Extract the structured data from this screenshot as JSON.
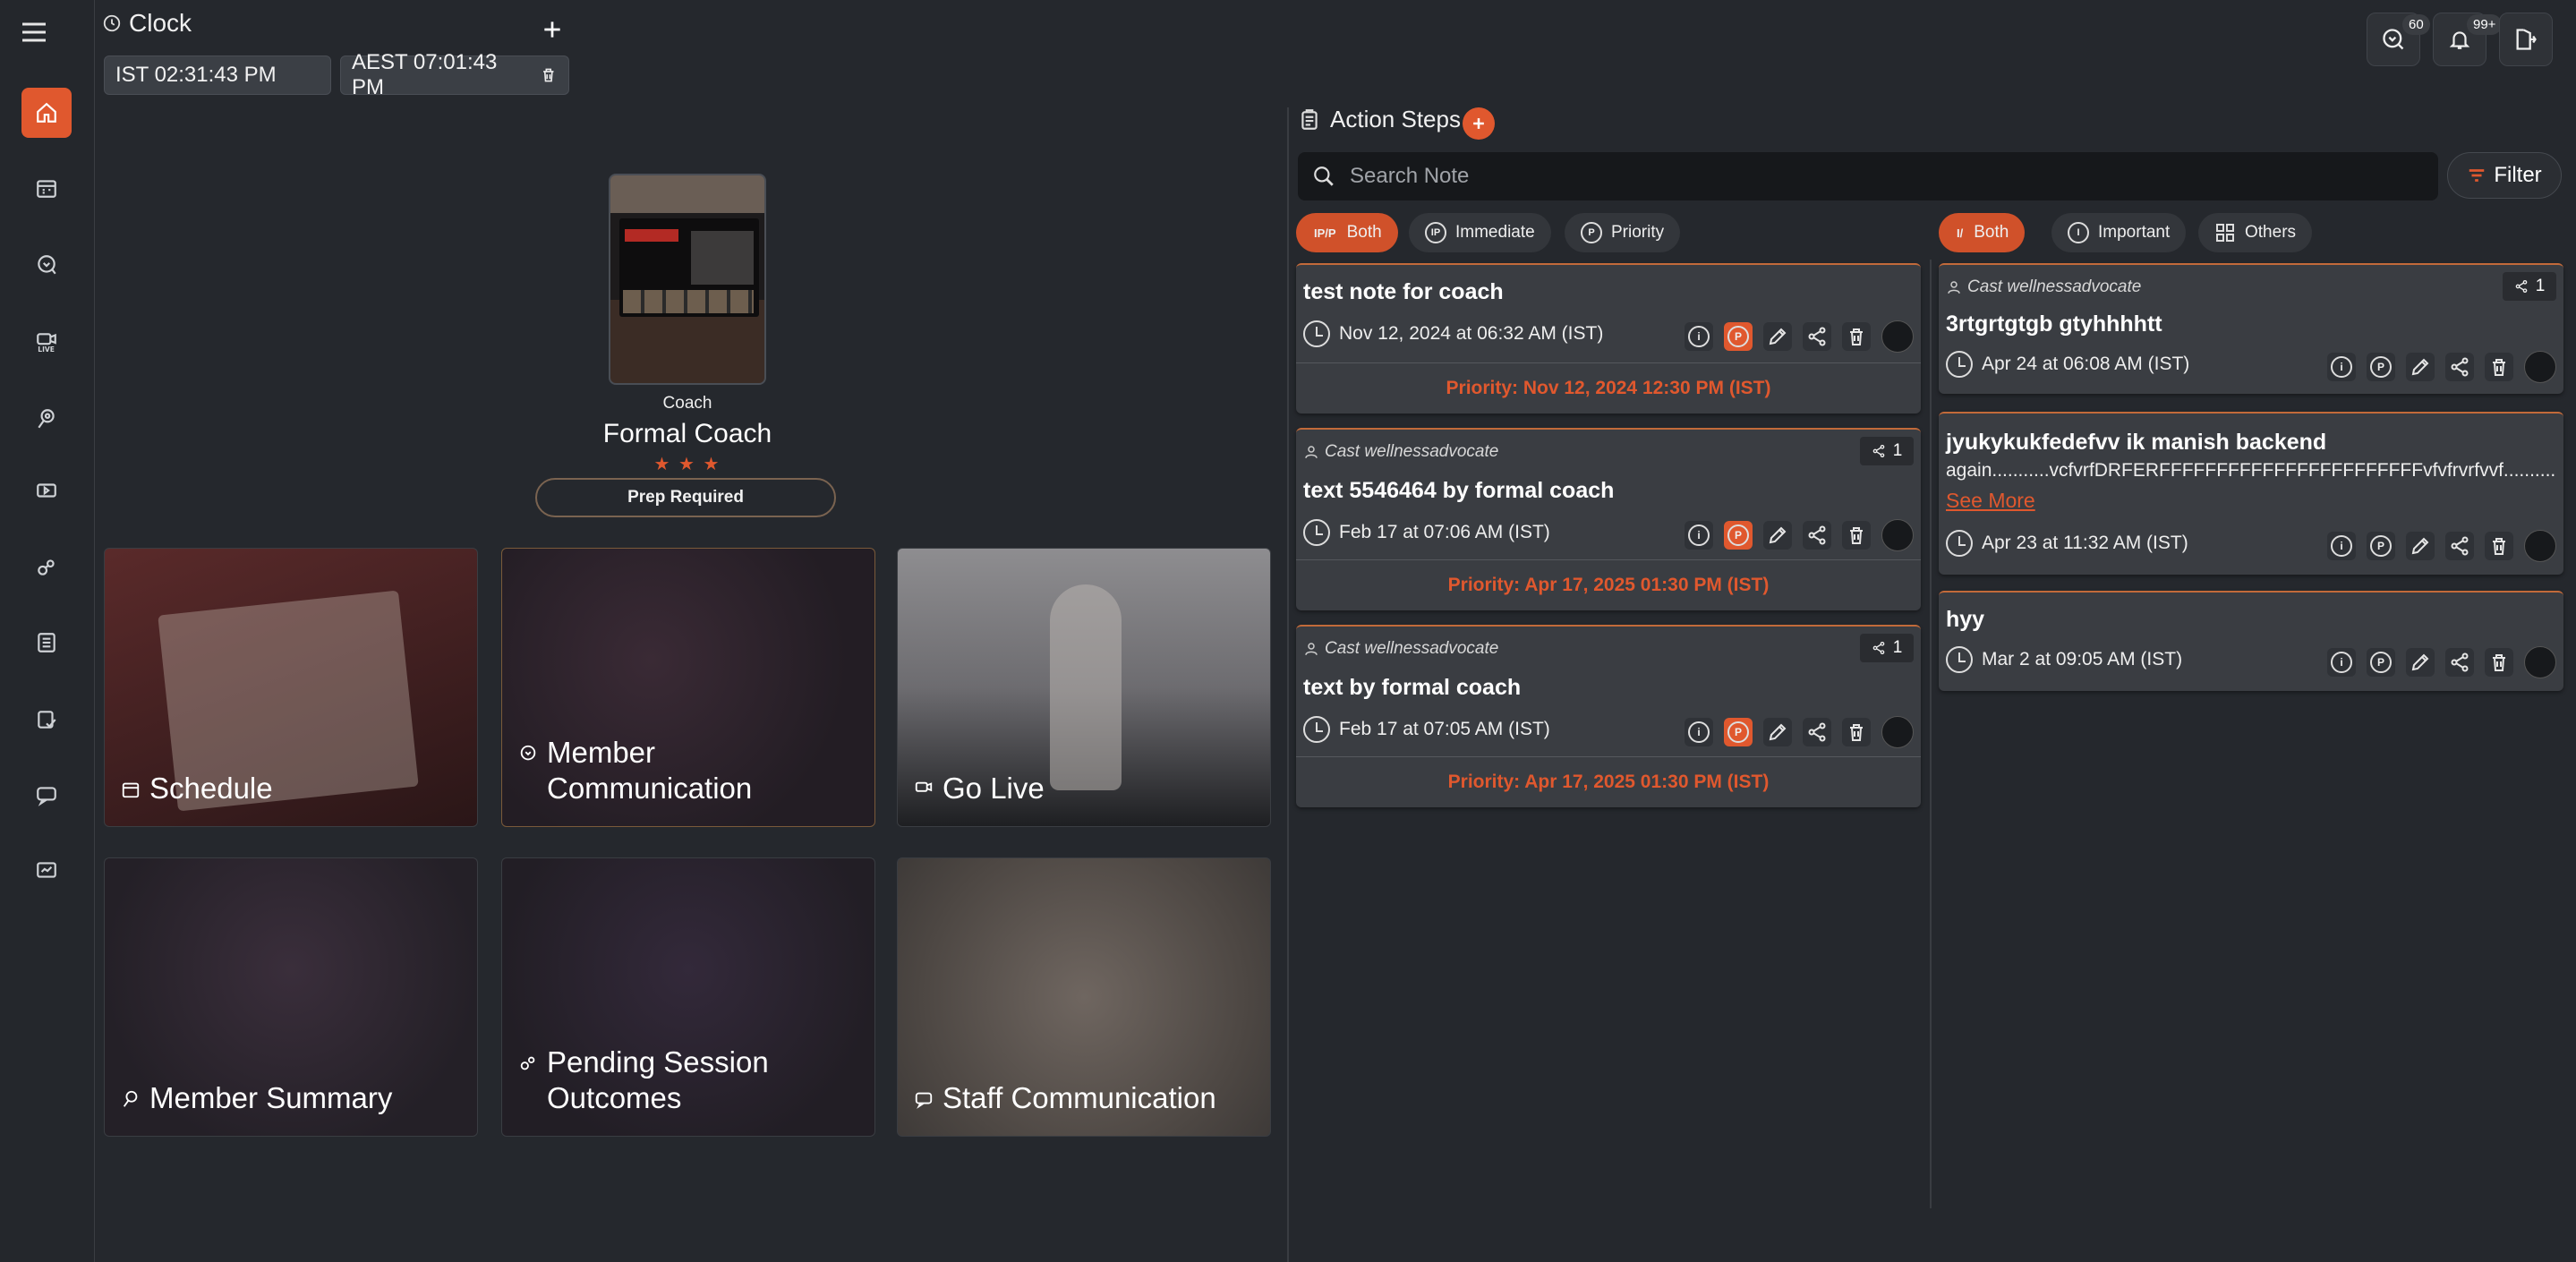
{
  "clock": {
    "title": "Clock",
    "zones": [
      {
        "text": "IST 02:31:43 PM"
      },
      {
        "text": "AEST 07:01:43 PM"
      }
    ]
  },
  "header": {
    "messages_badge": "60",
    "notifications_badge": "99+"
  },
  "coach": {
    "role": "Coach",
    "name": "Formal Coach",
    "stars": "★ ★ ★",
    "prep_label": "Prep Required"
  },
  "tiles": [
    {
      "label": "Schedule",
      "icon": "calendar-icon"
    },
    {
      "label": "Member Communication",
      "icon": "chat-icon"
    },
    {
      "label": "Go Live",
      "icon": "live-video-icon"
    },
    {
      "label": "Member Summary",
      "icon": "summary-icon"
    },
    {
      "label": "Pending Session Outcomes",
      "icon": "outcomes-icon"
    },
    {
      "label": "Staff Communication",
      "icon": "staff-chat-icon"
    }
  ],
  "action_steps": {
    "title": "Action Steps",
    "search_placeholder": "Search Note",
    "filter_label": "Filter",
    "left_filters": [
      {
        "code": "IP/P",
        "label": "Both"
      },
      {
        "code": "IP",
        "label": "Immediate"
      },
      {
        "code": "P",
        "label": "Priority"
      }
    ],
    "right_filters": [
      {
        "code": "I/",
        "label": "Both"
      },
      {
        "code": "I",
        "label": "Important"
      },
      {
        "code": "",
        "label": "Others"
      }
    ],
    "left_cards": [
      {
        "title": "test note for coach",
        "cast": "",
        "share": "",
        "date": "Nov 12, 2024 at 06:32 AM (IST)",
        "priority": "Priority: Nov 12, 2024 12:30 PM (IST)"
      },
      {
        "title": "text 5546464 by formal coach",
        "cast": "Cast wellnessadvocate",
        "share": "1",
        "date": "Feb 17 at 07:06 AM (IST)",
        "priority": "Priority: Apr 17, 2025 01:30 PM (IST)"
      },
      {
        "title": "text by formal coach",
        "cast": "Cast wellnessadvocate",
        "share": "1",
        "date": "Feb 17 at 07:05 AM (IST)",
        "priority": "Priority: Apr 17, 2025 01:30 PM (IST)"
      }
    ],
    "right_cards": [
      {
        "title": "3rtgrtgtgb gtyhhhhtt",
        "cast": "Cast wellnessadvocate",
        "share": "1",
        "body": "",
        "see_more": "",
        "date": "Apr 24 at 06:08 AM (IST)"
      },
      {
        "title": "jyukykukfedefvv ik manish backend",
        "cast": "",
        "share": "",
        "body": "again...........vcfvrfDRFERFFFFFFFFFFFFFFFFFFFFFFFvfvfrvrfvvf..............",
        "see_more": "See More",
        "date": "Apr 23 at 11:32 AM (IST)"
      },
      {
        "title": "hyy",
        "cast": "",
        "share": "",
        "body": "",
        "see_more": "",
        "date": "Mar 2 at 09:05 AM (IST)"
      }
    ]
  },
  "colors": {
    "accent": "#e0582e",
    "background": "#25282d",
    "card": "#3a3d42"
  }
}
